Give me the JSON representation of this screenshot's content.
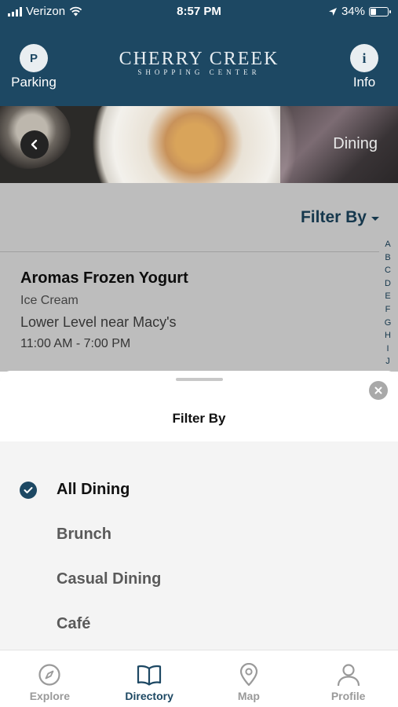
{
  "status_bar": {
    "carrier": "Verizon",
    "time": "8:57 PM",
    "battery": "34%",
    "battery_level": 0.34
  },
  "header": {
    "left_button": {
      "icon_letter": "P",
      "label": "Parking"
    },
    "logo": {
      "main": "CHERRY CREEK",
      "sub": "SHOPPING CENTER"
    },
    "right_button": {
      "icon_letter": "i",
      "label": "Info"
    }
  },
  "hero": {
    "title": "Dining"
  },
  "list": {
    "filter_label": "Filter By",
    "alphabet": [
      "A",
      "B",
      "C",
      "D",
      "E",
      "F",
      "G",
      "H",
      "I",
      "J"
    ],
    "store": {
      "name": "Aromas Frozen Yogurt",
      "category": "Ice Cream",
      "location": "Lower Level near Macy's",
      "hours": "11:00 AM - 7:00 PM"
    }
  },
  "sheet": {
    "title": "Filter By",
    "options": [
      {
        "label": "All Dining",
        "selected": true
      },
      {
        "label": "Brunch",
        "selected": false
      },
      {
        "label": "Casual Dining",
        "selected": false
      },
      {
        "label": "Café",
        "selected": false
      }
    ]
  },
  "tabs": [
    {
      "label": "Explore",
      "icon": "compass-icon",
      "active": false
    },
    {
      "label": "Directory",
      "icon": "book-icon",
      "active": true
    },
    {
      "label": "Map",
      "icon": "map-pin-icon",
      "active": false
    },
    {
      "label": "Profile",
      "icon": "person-icon",
      "active": false
    }
  ],
  "colors": {
    "brand": "#1d4863",
    "inactive_tab": "#9a9a9a"
  }
}
